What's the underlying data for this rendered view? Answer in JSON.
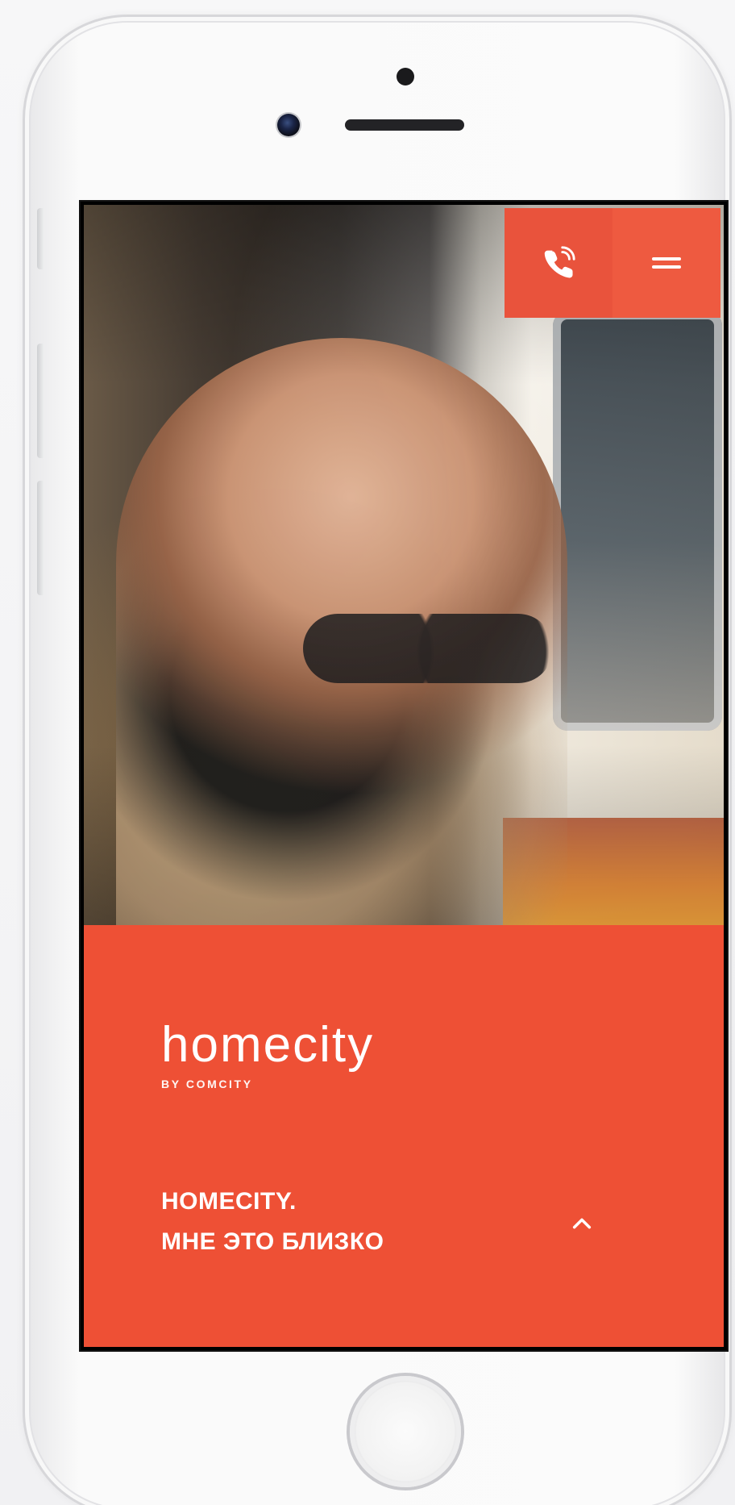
{
  "screen": {
    "header": {
      "phone_button_icon": "phone-icon",
      "menu_button_icon": "menu-icon"
    },
    "brand": {
      "name": "homecity",
      "subtitle": "BY COMCITY"
    },
    "hero_text": {
      "line1": "HOMECITY.",
      "line2": "МНЕ ЭТО БЛИЗКО"
    },
    "scroll_button_icon": "chevron-up-icon",
    "accent_color": "#ee5035"
  }
}
